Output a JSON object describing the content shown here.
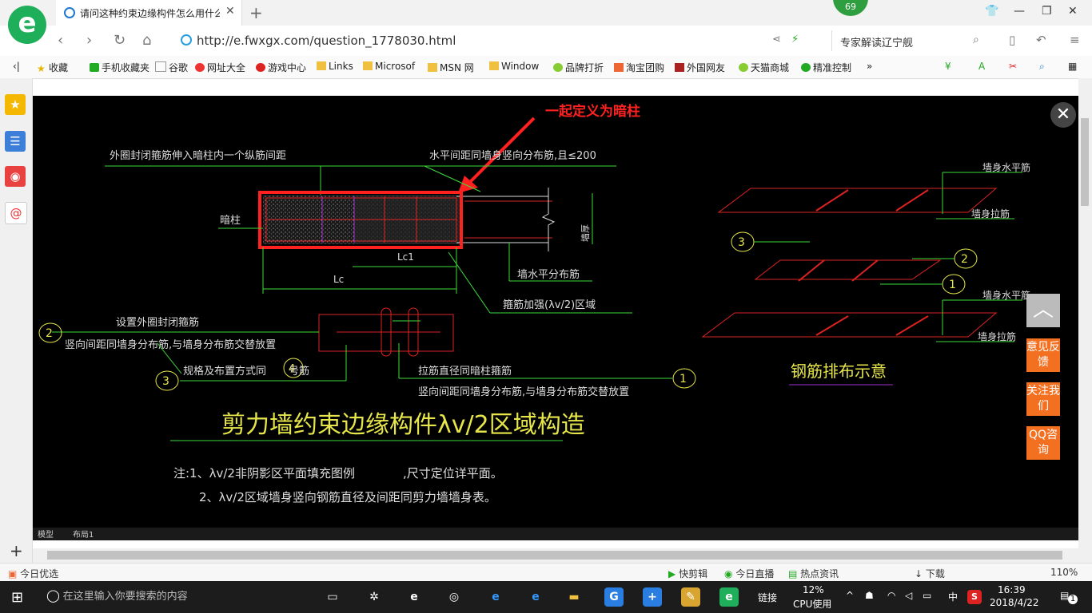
{
  "browser": {
    "tab_title": "请问这种约束边缘构件怎么用什么",
    "tab_close": "✕",
    "new_tab": "+",
    "badge_count": "69",
    "url": "http://e.fwxgx.com/question_1778030.html",
    "search_text": "专家解读辽宁舰"
  },
  "bookmarks": [
    "收藏",
    "手机收藏夹",
    "谷歌",
    "网址大全",
    "游戏中心",
    "Links",
    "Microsof",
    "MSN 网",
    "Window",
    "品牌打折",
    "淘宝团购",
    "外国网友",
    "天猫商城",
    "精准控制"
  ],
  "cad": {
    "annotation": "一起定义为暗柱",
    "label_outer": "外圈封闭箍筋伸入暗柱内一个纵筋间距",
    "label_horiz": "水平间距同墙身竖向分布筋,且≤200",
    "label_anzhu": "暗柱",
    "label_lc1": "Lc1",
    "label_lc": "Lc",
    "label_wall_thick": "墙厚",
    "label_wall_horiz": "墙水平分布筋",
    "label_stirrup_zone": "箍筋加强(λv/2)区域",
    "c2_a": "设置外圈封闭箍筋",
    "c2_b": "竖向间距同墙身分布筋,与墙身分布筋交替放置",
    "c3": "规格及布置方式同",
    "c4": "号筋",
    "c1_a": "拉筋直径同暗柱箍筋",
    "c1_b": "竖向间距同墙身分布筋,与墙身分布筋交替放置",
    "circle1": "1",
    "circle2": "2",
    "circle3": "3",
    "circle4": "4",
    "main_title": "剪力墙约束边缘构件λv/2区域构造",
    "note1": "注:1、λv/2非阴影区平面填充图例　　　　,尺寸定位详平面。",
    "note2": "2、λv/2区域墙身竖向钢筋直径及间距同剪力墙墙身表。",
    "r_h1": "墙身水平筋",
    "r_tie1": "墙身拉筋",
    "r_h2": "墙身水平筋",
    "r_tie2": "墙身拉筋",
    "r_title": "钢筋排布示意",
    "tab_model": "模型",
    "tab_layout": "布局1"
  },
  "float_buttons": [
    "意见反馈",
    "关注我们",
    "QQ咨询"
  ],
  "status_bar": {
    "left": "今日优选",
    "items": [
      "快剪辑",
      "今日直播",
      "热点资讯",
      "下载"
    ],
    "zoom": "110%"
  },
  "taskbar": {
    "search_placeholder": "在这里输入你要搜索的内容",
    "link": "链接",
    "cpu_pct": "12%",
    "cpu_label": "CPU使用",
    "ime": "中",
    "time": "16:39",
    "date": "2018/4/22",
    "notif_count": "1"
  },
  "colors": {
    "cad_bg": "#000000",
    "annotation_red": "#ff2020",
    "cad_yellow": "#e6e64a",
    "cad_green": "#3ddc3d",
    "accent_orange": "#f37021"
  }
}
